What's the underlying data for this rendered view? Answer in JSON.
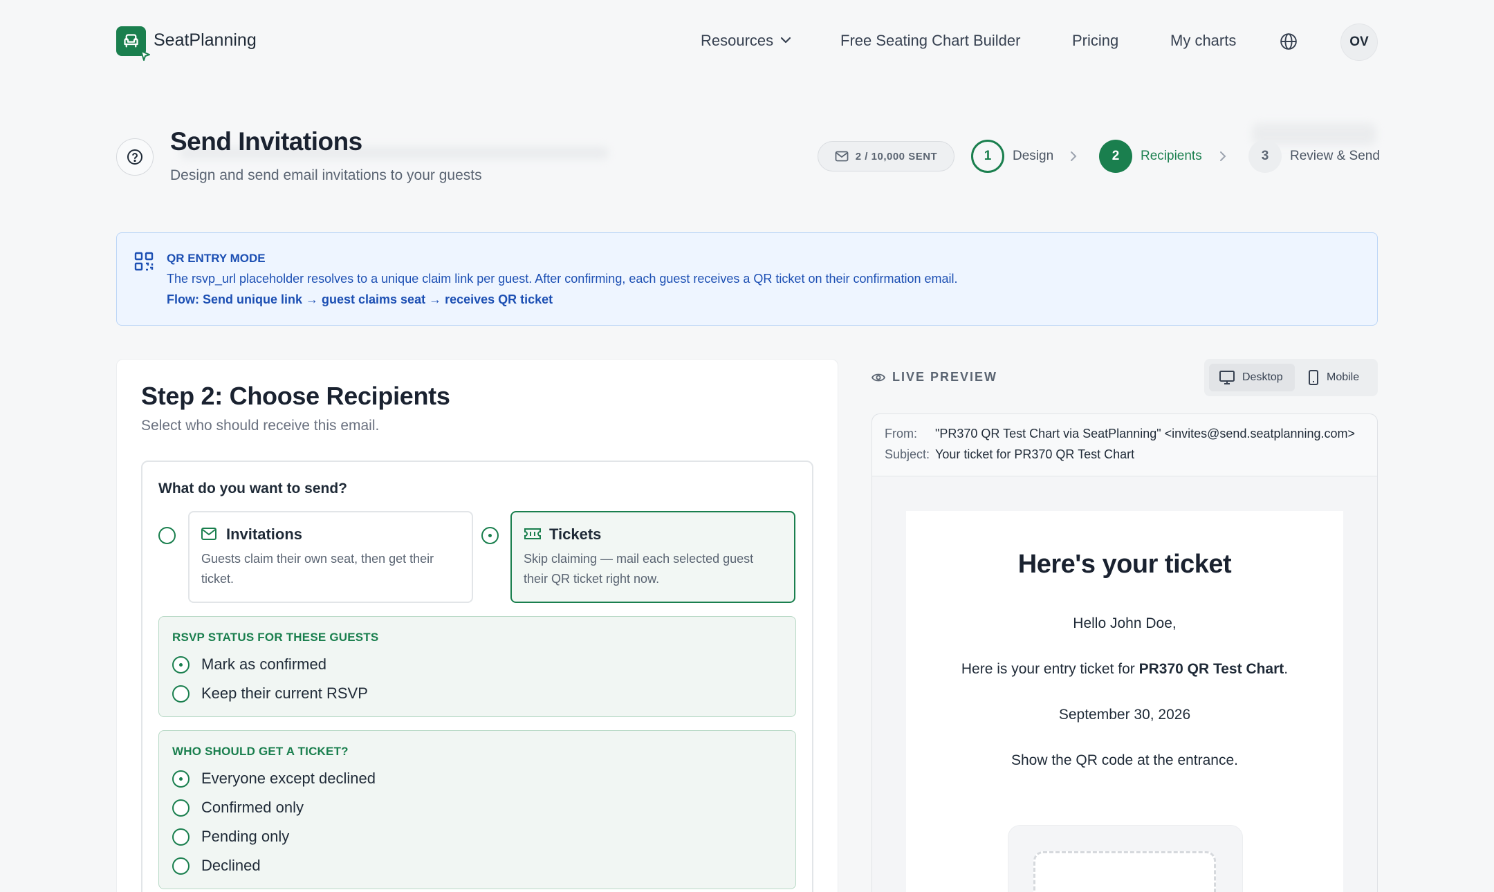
{
  "nav": {
    "brand": "SeatPlanning",
    "resources": "Resources",
    "builder": "Free Seating Chart Builder",
    "pricing": "Pricing",
    "my_charts": "My charts",
    "avatar_initials": "OV"
  },
  "header": {
    "title": "Send Invitations",
    "subtitle": "Design and send email invitations to your guests",
    "sent_counter": "2 / 10,000 SENT",
    "steps": [
      {
        "number": "1",
        "label": "Design",
        "state": "completed"
      },
      {
        "number": "2",
        "label": "Recipients",
        "state": "active"
      },
      {
        "number": "3",
        "label": "Review & Send",
        "state": "upcoming"
      }
    ]
  },
  "qr_banner": {
    "title": "QR ENTRY MODE",
    "line1": "The rsvp_url placeholder resolves to a unique claim link per guest. After confirming, each guest receives a QR ticket on their confirmation email.",
    "line2": "Flow: Send unique link → guest claims seat → receives QR ticket"
  },
  "recipients": {
    "heading": "Step 2: Choose Recipients",
    "description": "Select who should receive this email.",
    "send_question": "What do you want to send?",
    "send_options": [
      {
        "title": "Invitations",
        "description_line1": "Guests claim their own seat, then get their",
        "description_line2": "ticket.",
        "selected": false
      },
      {
        "title": "Tickets",
        "description_line1": "Skip claiming — mail each selected guest",
        "description_line2": "their QR ticket right now.",
        "selected": true
      }
    ],
    "rsvp_section": {
      "title": "RSVP STATUS FOR THESE GUESTS",
      "options": [
        {
          "label": "Mark as confirmed",
          "selected": true
        },
        {
          "label": "Keep their current RSVP",
          "selected": false
        }
      ]
    },
    "ticket_section": {
      "title": "WHO SHOULD GET A TICKET?",
      "options": [
        {
          "label": "Everyone except declined",
          "selected": true
        },
        {
          "label": "Confirmed only",
          "selected": false
        },
        {
          "label": "Pending only",
          "selected": false
        },
        {
          "label": "Declined",
          "selected": false
        }
      ]
    }
  },
  "preview": {
    "label": "LIVE PREVIEW",
    "desktop": "Desktop",
    "mobile": "Mobile",
    "active_device": "Desktop",
    "from_key": "From:",
    "from_value": "\"PR370 QR Test Chart via SeatPlanning\" <invites@send.seatplanning.com>",
    "subject_key": "Subject:",
    "subject_value": "Your ticket for PR370 QR Test Chart",
    "email": {
      "heading": "Here's your ticket",
      "greeting": "Hello John Doe,",
      "intro_prefix": "Here is your entry ticket for ",
      "event_name": "PR370 QR Test Chart",
      "intro_suffix": ".",
      "date": "September 30, 2026",
      "instruction": "Show the QR code at the entrance."
    }
  },
  "colors": {
    "brand_green": "#1a7f4e",
    "banner_blue": "#1c4fb3",
    "banner_bg": "#eef5ff"
  }
}
